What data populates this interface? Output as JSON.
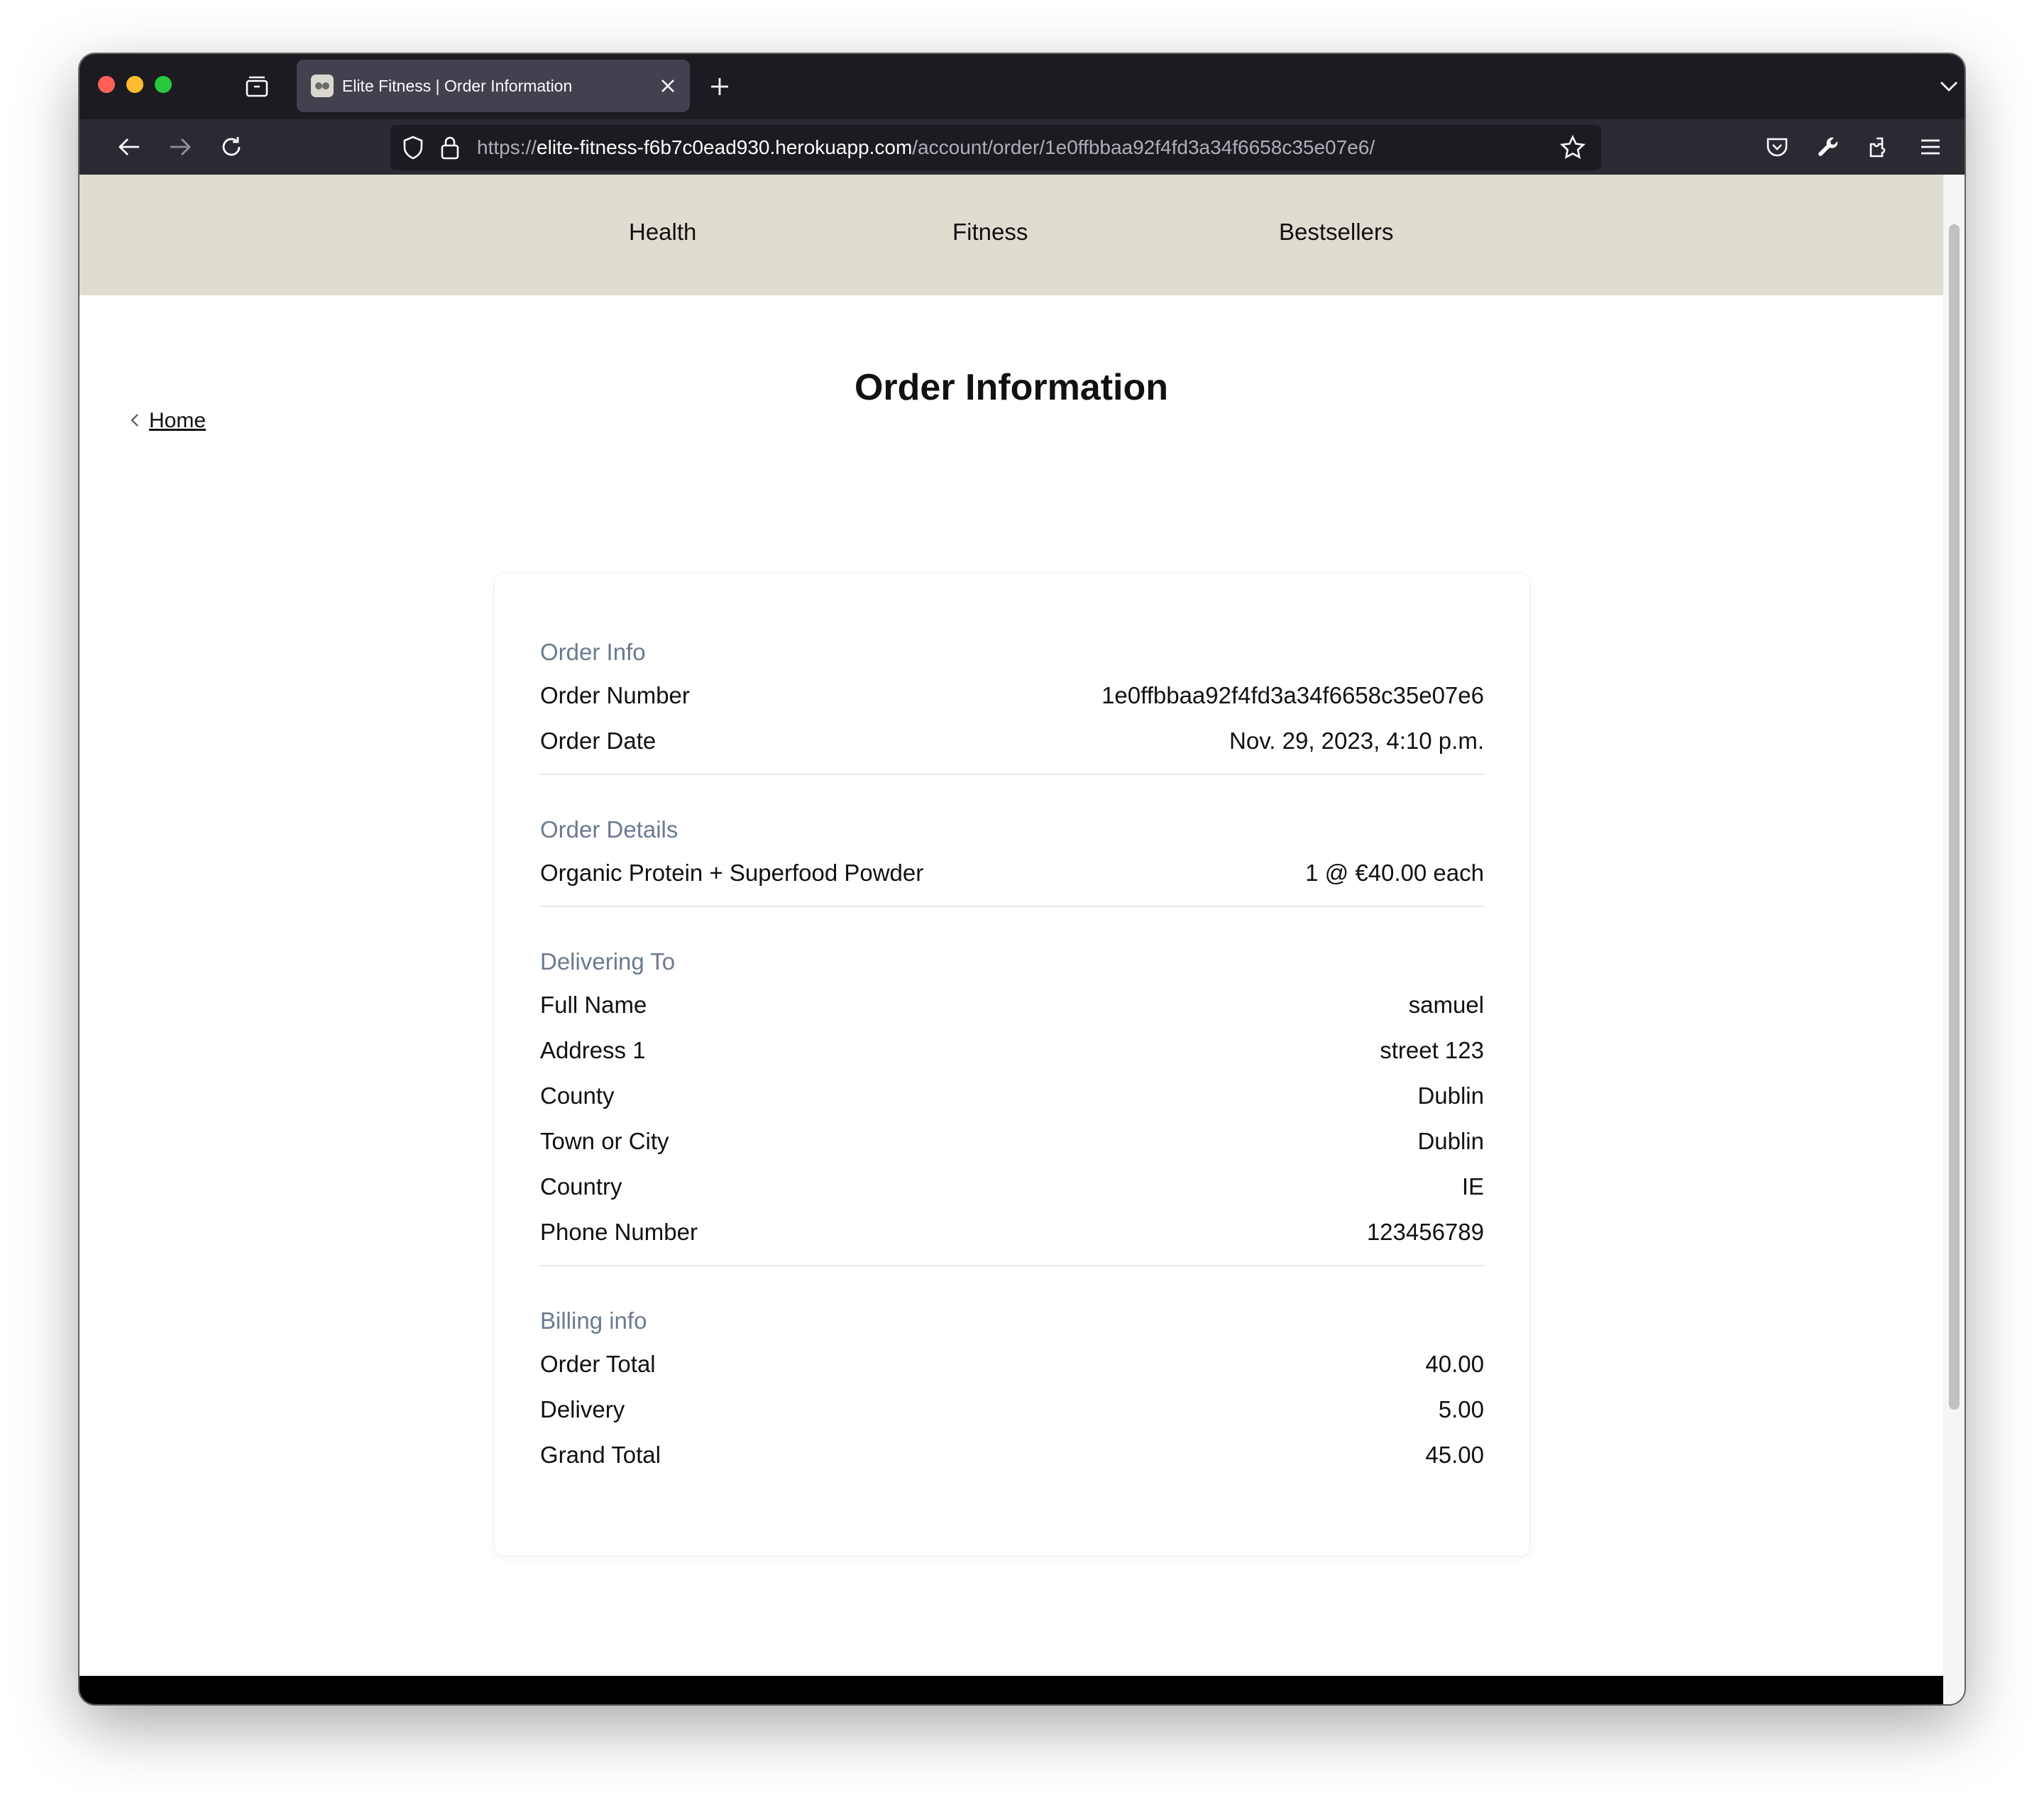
{
  "browser": {
    "tab": {
      "title": "Elite Fitness | Order Information"
    },
    "url": {
      "prefix": "https://",
      "host": "elite-fitness-f6b7c0ead930.herokuapp.com",
      "path": "/account/order/1e0ffbbaa92f4fd3a34f6658c35e07e6/"
    },
    "icons": [
      "tab-overview-icon",
      "close-icon",
      "plus-icon",
      "chevron-down-icon",
      "back-arrow-icon",
      "forward-arrow-icon",
      "reload-icon",
      "shield-icon",
      "lock-icon",
      "star-icon",
      "pocket-icon",
      "wrench-icon",
      "extensions-icon",
      "hamburger-menu-icon"
    ]
  },
  "site_nav": {
    "items": [
      "Health",
      "Fitness",
      "Bestsellers"
    ]
  },
  "page": {
    "title": "Order Information",
    "back_label": "Home"
  },
  "order": {
    "info": {
      "heading": "Order Info",
      "rows": [
        {
          "label": "Order Number",
          "value": "1e0ffbbaa92f4fd3a34f6658c35e07e6"
        },
        {
          "label": "Order Date",
          "value": "Nov. 29, 2023, 4:10 p.m."
        }
      ]
    },
    "details": {
      "heading": "Order Details",
      "rows": [
        {
          "label": "Organic Protein + Superfood Powder",
          "value": "1 @ €40.00 each"
        }
      ]
    },
    "delivery": {
      "heading": "Delivering To",
      "rows": [
        {
          "label": "Full Name",
          "value": "samuel"
        },
        {
          "label": "Address 1",
          "value": "street 123"
        },
        {
          "label": "County",
          "value": "Dublin"
        },
        {
          "label": "Town or City",
          "value": "Dublin"
        },
        {
          "label": "Country",
          "value": "IE"
        },
        {
          "label": "Phone Number",
          "value": "123456789"
        }
      ]
    },
    "billing": {
      "heading": "Billing info",
      "rows": [
        {
          "label": "Order Total",
          "value": "40.00"
        },
        {
          "label": "Delivery",
          "value": "5.00"
        },
        {
          "label": "Grand Total",
          "value": "45.00"
        }
      ]
    }
  },
  "colors": {
    "site_nav_bg": "#dfdcd0",
    "section_heading": "#6b7a90",
    "footer_bg": "#000000",
    "browser_chrome": "#1c1b22"
  }
}
